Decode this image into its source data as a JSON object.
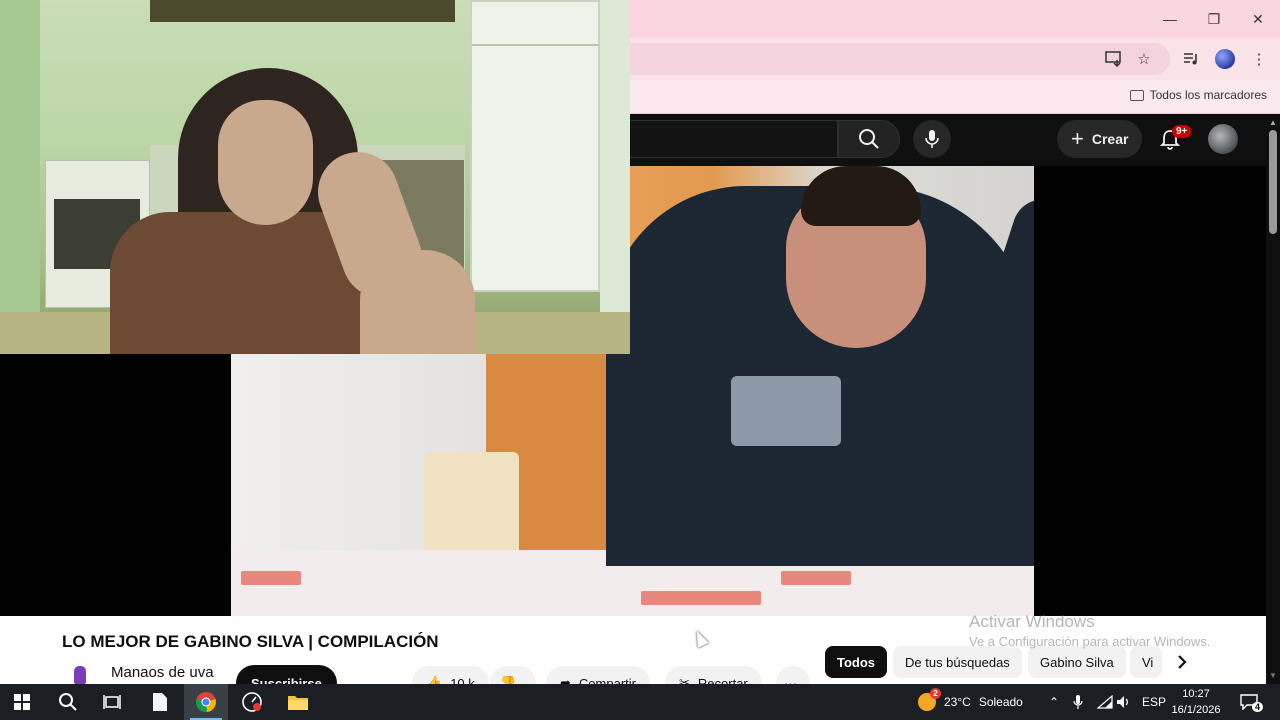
{
  "browser": {
    "bookmarks_all_label": "Todos los marcadores"
  },
  "youtube": {
    "create_label": "Crear",
    "notifications_badge": "9+",
    "video_title": "LO MEJOR DE GABINO SILVA | COMPILACIÓN",
    "channel_name": "Manaos de uva",
    "subscribe_label": "Suscribirse",
    "likes": "10 k",
    "share_label": "Compartir",
    "clip_label": "Recortar",
    "more_label": "···",
    "chips": [
      "Todos",
      "De tus búsquedas",
      "Gabino Silva",
      "Vi"
    ]
  },
  "windows_activation": {
    "title": "Activar Windows",
    "subtitle": "Ve a Configuración para activar Windows."
  },
  "taskbar": {
    "weather_temp": "23°C",
    "weather_desc": "Soleado",
    "weather_badge": "2",
    "language": "ESP",
    "time": "10:27",
    "date": "16/1/2026",
    "notifications_count": "4"
  },
  "colors": {
    "chrome_titlebar": "#f9d6e0",
    "youtube_dark": "#0f0f0f",
    "youtube_red": "#cc0000",
    "taskbar": "#1b1f24"
  }
}
